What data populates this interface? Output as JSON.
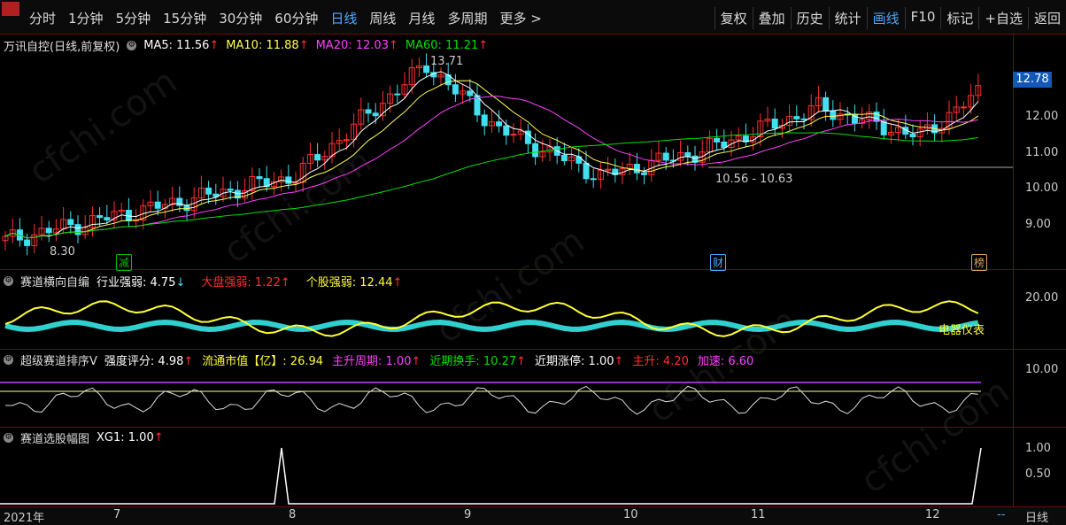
{
  "toolbar": {
    "left": [
      "分时",
      "1分钟",
      "5分钟",
      "15分钟",
      "30分钟",
      "60分钟",
      "日线",
      "周线",
      "月线",
      "多周期",
      "更多 >"
    ],
    "active_left": "日线",
    "right": [
      "复权",
      "叠加",
      "历史",
      "统计",
      "画线",
      "F10",
      "标记",
      "+自选",
      "返回"
    ],
    "active_right": "画线"
  },
  "main": {
    "title": "万讯自控(日线,前复权)",
    "ma": [
      {
        "label": "MA5: 11.56",
        "color": "#ffffff"
      },
      {
        "label": "MA10: 11.88",
        "color": "#ffff55"
      },
      {
        "label": "MA20: 12.03",
        "color": "#ff40ff"
      },
      {
        "label": "MA60: 11.21",
        "color": "#00e000"
      }
    ],
    "arrow": "↑",
    "high_label": "13.71",
    "low_label": "8.30",
    "range_label": "10.56 - 10.63",
    "price_tag": "12.78",
    "ticks": [
      "12.00",
      "11.00",
      "10.00",
      "9.00"
    ],
    "badges": [
      {
        "text": "减",
        "color": "#00c000"
      },
      {
        "text": "财",
        "color": "#4fa8ff"
      },
      {
        "text": "榜",
        "color": "#e0a060"
      }
    ]
  },
  "panel2": {
    "title": "赛道横向自编",
    "items": [
      {
        "label": "行业强弱: 4.75",
        "arrow": "↓",
        "color": "#ffffff"
      },
      {
        "label": "大盘强弱: 1.22",
        "arrow": "↑",
        "color": "#ff3030"
      },
      {
        "label": "个股强弱: 12.44",
        "arrow": "↑",
        "color": "#ffff33"
      }
    ],
    "tick": "20.00",
    "note": "电器仪表"
  },
  "panel3": {
    "title": "超级赛道排序V",
    "items": [
      {
        "label": "强度评分: 4.98",
        "arrow": "↑",
        "color": "#ffffff"
      },
      {
        "label": "流通市值【亿】: 26.94",
        "arrow": "",
        "color": "#ffff33"
      },
      {
        "label": "主升周期: 1.00",
        "arrow": "↑",
        "color": "#ff40ff"
      },
      {
        "label": "近期换手: 10.27",
        "arrow": "↑",
        "color": "#00e000"
      },
      {
        "label": "近期涨停: 1.00",
        "arrow": "↑",
        "color": "#ffffff"
      },
      {
        "label": "主升: 4.20",
        "arrow": "",
        "color": "#ff3030"
      },
      {
        "label": "加速: 6.60",
        "arrow": "",
        "color": "#ff40ff"
      }
    ],
    "tick": "10.00"
  },
  "panel4": {
    "title": "赛道选股幅图",
    "items": [
      {
        "label": "XG1: 1.00",
        "arrow": "↑",
        "color": "#ffffff"
      }
    ],
    "ticks": [
      "1.00",
      "0.50"
    ]
  },
  "xaxis": {
    "labels": [
      "2021年",
      "7",
      "8",
      "9",
      "10",
      "11",
      "12"
    ],
    "period": "日线",
    "more": "--"
  },
  "watermark": "cfchi.com",
  "colors": {
    "up": "#ff3030",
    "down": "#40e0f0",
    "ma5": "#ffffff",
    "ma10": "#ffff55",
    "ma20": "#ff40ff",
    "ma60": "#00e000",
    "grid": "#6b0b0b"
  }
}
